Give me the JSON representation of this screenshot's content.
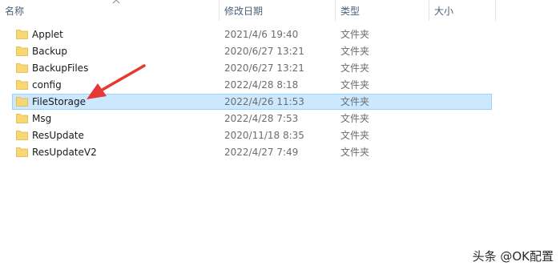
{
  "columns": {
    "name": "名称",
    "date": "修改日期",
    "type": "类型",
    "size": "大小"
  },
  "files": [
    {
      "name": "Applet",
      "date": "2021/4/6 19:40",
      "type": "文件夹"
    },
    {
      "name": "Backup",
      "date": "2020/6/27 13:21",
      "type": "文件夹"
    },
    {
      "name": "BackupFiles",
      "date": "2020/6/27 13:21",
      "type": "文件夹"
    },
    {
      "name": "config",
      "date": "2022/4/28 8:18",
      "type": "文件夹"
    },
    {
      "name": "FileStorage",
      "date": "2022/4/26 11:53",
      "type": "文件夹",
      "selected": true
    },
    {
      "name": "Msg",
      "date": "2022/4/28 7:53",
      "type": "文件夹"
    },
    {
      "name": "ResUpdate",
      "date": "2020/11/18 8:35",
      "type": "文件夹"
    },
    {
      "name": "ResUpdateV2",
      "date": "2022/4/27 7:49",
      "type": "文件夹"
    }
  ],
  "annotation": {
    "color": "#e53935",
    "icon": "arrow-icon"
  },
  "watermark": "头条 @OK配置",
  "colors": {
    "selection_bg": "#cce8ff",
    "selection_border": "#99d1ff",
    "folder": "#f8d775"
  }
}
